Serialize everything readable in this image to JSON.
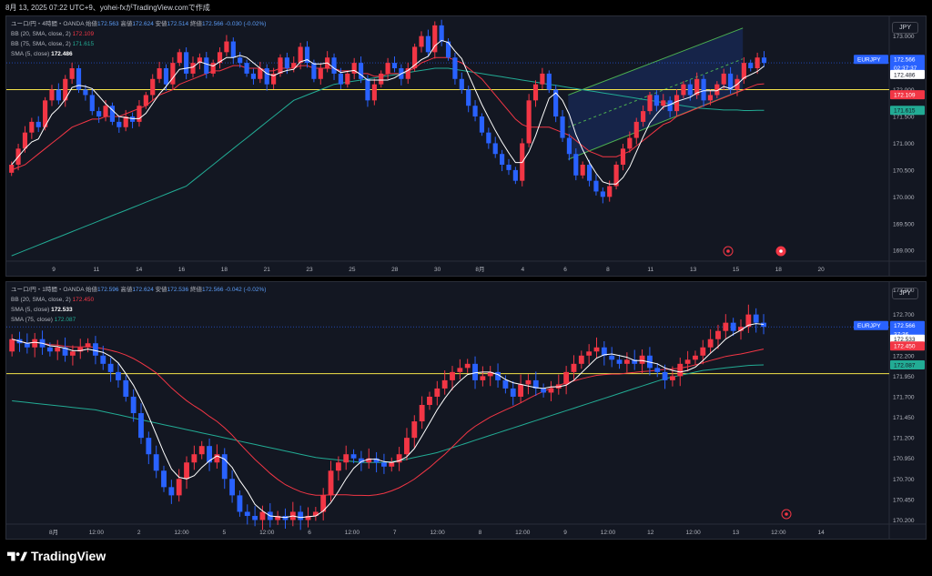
{
  "header": {
    "text": "8月 13, 2025 07:22 UTC+9、yohei-fxがTradingView.comで作成"
  },
  "footer": {
    "brand": "TradingView"
  },
  "colors": {
    "up": "#f23645",
    "down": "#2962ff",
    "bb20": "#f23645",
    "bb75": "#22ab94",
    "sma5": "#ffffff",
    "hline": "#f5e44a",
    "channel": "#4caf50"
  },
  "pane1": {
    "symbol_line": "ユーロ/円・4時間・OANDA",
    "ohlc": {
      "o_label": "始値",
      "o": "172.563",
      "h_label": "高値",
      "h": "172.624",
      "l_label": "安値",
      "l": "172.514",
      "c_label": "終値",
      "c": "172.566",
      "chg": "-0.030 (-0.02%)"
    },
    "ind1_label": "BB (20, SMA, close, 2)",
    "ind1_val": "172.109",
    "ind2_label": "BB (75, SMA, close, 2)",
    "ind2_val": "171.615",
    "ind3_label": "SMA (5, close)",
    "ind3_val": "172.486",
    "currency": "JPY",
    "badges": {
      "sym": "EURJPY",
      "price": "172.566",
      "timer": "02:37:37",
      "sma": "172.486",
      "bb20": "172.109",
      "bb75": "171.615"
    }
  },
  "pane2": {
    "symbol_line": "ユーロ/円・1時間・OANDA",
    "ohlc": {
      "o_label": "始値",
      "o": "172.596",
      "h_label": "高値",
      "h": "172.624",
      "l_label": "安値",
      "l": "172.536",
      "c_label": "終値",
      "c": "172.566",
      "chg": "-0.042 (-0.02%)"
    },
    "ind1_label": "BB (20, SMA, close, 2)",
    "ind1_val": "172.450",
    "ind2_label": "SMA (5, close)",
    "ind2_val": "172.533",
    "ind3_label": "SMA (75, close)",
    "ind3_val": "172.087",
    "currency": "JPY",
    "badges": {
      "sym": "EURJPY",
      "price": "172.566",
      "timer": "37:36",
      "sma": "172.533",
      "bb20": "172.450",
      "sma75": "172.087"
    }
  },
  "chart_data": [
    {
      "type": "candlestick",
      "title": "ユーロ/円・4時間・OANDA",
      "ylim": [
        168.8,
        173.3
      ],
      "yticks": [
        "173.500",
        "173.000",
        "172.500",
        "172.000",
        "171.500",
        "171.000",
        "170.500",
        "170.000",
        "169.500",
        "169.000"
      ],
      "xticks": [
        "9",
        "11",
        "14",
        "16",
        "18",
        "21",
        "23",
        "25",
        "28",
        "30",
        "8月",
        "4",
        "6",
        "8",
        "11",
        "13",
        "15",
        "18",
        "20"
      ],
      "hline": 172.0,
      "closes": [
        170.6,
        170.9,
        171.2,
        171.4,
        171.3,
        171.8,
        172.0,
        171.8,
        172.2,
        172.4,
        172.0,
        171.9,
        171.6,
        171.5,
        171.7,
        171.4,
        171.3,
        171.5,
        171.4,
        171.7,
        171.9,
        172.2,
        172.4,
        172.1,
        172.5,
        172.7,
        172.3,
        172.5,
        172.6,
        172.3,
        172.5,
        172.7,
        172.9,
        172.6,
        172.5,
        172.3,
        172.2,
        172.4,
        172.1,
        172.3,
        172.6,
        172.4,
        172.5,
        172.8,
        172.5,
        172.2,
        172.4,
        172.6,
        172.3,
        172.1,
        172.3,
        172.5,
        172.2,
        171.8,
        172.1,
        172.3,
        172.5,
        172.4,
        172.2,
        172.4,
        172.8,
        173.0,
        172.7,
        173.2,
        172.9,
        172.6,
        172.2,
        172.0,
        171.7,
        171.5,
        171.2,
        171.0,
        170.8,
        170.6,
        170.5,
        170.3,
        171.0,
        171.8,
        172.1,
        172.3,
        172.0,
        171.5,
        171.1,
        170.8,
        170.4,
        170.6,
        170.3,
        170.1,
        170.0,
        170.2,
        170.6,
        170.9,
        171.1,
        171.4,
        171.6,
        171.9,
        171.7,
        171.8,
        171.6,
        171.9,
        172.1,
        171.9,
        172.2,
        171.8,
        171.9,
        172.1,
        172.3,
        172.0,
        172.2,
        172.5,
        172.4,
        172.6,
        172.5
      ],
      "bb20": [
        170.5,
        170.55,
        170.6,
        170.7,
        170.8,
        170.9,
        171.0,
        171.1,
        171.2,
        171.3,
        171.35,
        171.4,
        171.45,
        171.45,
        171.5,
        171.5,
        171.5,
        171.55,
        171.6,
        171.65,
        171.7,
        171.8,
        171.9,
        171.95,
        172.0,
        172.1,
        172.15,
        172.2,
        172.25,
        172.3,
        172.35,
        172.35,
        172.4,
        172.45,
        172.45,
        172.4,
        172.4,
        172.4,
        172.35,
        172.35,
        172.4,
        172.4,
        172.4,
        172.45,
        172.45,
        172.4,
        172.4,
        172.4,
        172.4,
        172.35,
        172.35,
        172.35,
        172.3,
        172.3,
        172.25,
        172.25,
        172.3,
        172.3,
        172.3,
        172.35,
        172.4,
        172.5,
        172.55,
        172.6,
        172.6,
        172.6,
        172.55,
        172.5,
        172.4,
        172.3,
        172.2,
        172.05,
        171.9,
        171.75,
        171.6,
        171.45,
        171.35,
        171.3,
        171.3,
        171.3,
        171.3,
        171.25,
        171.2,
        171.15,
        171.05,
        170.95,
        170.85,
        170.8,
        170.75,
        170.75,
        170.75,
        170.8,
        170.85,
        170.95,
        171.05,
        171.15,
        171.25,
        171.35,
        171.4,
        171.5,
        171.55,
        171.6,
        171.65,
        171.7,
        171.75,
        171.8,
        171.85,
        171.9,
        171.95,
        172.0,
        172.05,
        172.1,
        172.11
      ],
      "bb75": [
        168.9,
        168.95,
        169.0,
        169.05,
        169.1,
        169.15,
        169.2,
        169.25,
        169.3,
        169.35,
        169.4,
        169.45,
        169.5,
        169.55,
        169.6,
        169.65,
        169.7,
        169.75,
        169.8,
        169.85,
        169.9,
        169.95,
        170.0,
        170.05,
        170.1,
        170.15,
        170.2,
        170.3,
        170.4,
        170.5,
        170.6,
        170.7,
        170.8,
        170.9,
        171.0,
        171.1,
        171.2,
        171.3,
        171.4,
        171.5,
        171.6,
        171.7,
        171.8,
        171.85,
        171.9,
        171.95,
        172.0,
        172.05,
        172.1,
        172.12,
        172.14,
        172.16,
        172.18,
        172.2,
        172.22,
        172.24,
        172.26,
        172.28,
        172.3,
        172.32,
        172.34,
        172.36,
        172.38,
        172.4,
        172.4,
        172.4,
        172.38,
        172.36,
        172.34,
        172.32,
        172.3,
        172.28,
        172.26,
        172.24,
        172.22,
        172.2,
        172.18,
        172.16,
        172.14,
        172.12,
        172.1,
        172.08,
        172.06,
        172.04,
        172.02,
        172.0,
        171.98,
        171.96,
        171.94,
        171.92,
        171.9,
        171.88,
        171.86,
        171.84,
        171.82,
        171.8,
        171.78,
        171.76,
        171.74,
        171.72,
        171.7,
        171.68,
        171.66,
        171.65,
        171.64,
        171.63,
        171.62,
        171.62,
        171.62,
        171.61,
        171.61,
        171.615,
        171.615
      ],
      "channel": {
        "lower": [
          [
            0.74,
            170.7
          ],
          [
            0.97,
            172.0
          ]
        ],
        "upper": [
          [
            0.74,
            171.9
          ],
          [
            0.97,
            173.15
          ]
        ]
      }
    },
    {
      "type": "candlestick",
      "title": "ユーロ/円・1時間・OANDA",
      "ylim": [
        170.15,
        173.05
      ],
      "yticks": [
        "173.000",
        "172.700",
        "172.450",
        "172.200",
        "171.950",
        "171.700",
        "171.450",
        "171.200",
        "170.950",
        "170.700",
        "170.450",
        "170.200"
      ],
      "xticks": [
        "8月",
        "12:00",
        "2",
        "12:00",
        "5",
        "12:00",
        "6",
        "12:00",
        "7",
        "12:00",
        "8",
        "12:00",
        "9",
        "12:00",
        "12",
        "12:00",
        "13",
        "12:00",
        "14"
      ],
      "hline": 171.98,
      "closes": [
        172.4,
        172.35,
        172.3,
        172.4,
        172.3,
        172.25,
        172.3,
        172.2,
        172.25,
        172.3,
        172.35,
        172.2,
        172.1,
        172.0,
        171.9,
        171.7,
        171.5,
        171.2,
        171.0,
        170.8,
        170.6,
        170.5,
        170.7,
        170.9,
        171.0,
        171.1,
        170.9,
        171.0,
        170.7,
        170.5,
        170.3,
        170.25,
        170.2,
        170.3,
        170.2,
        170.25,
        170.2,
        170.3,
        170.2,
        170.25,
        170.3,
        170.5,
        170.8,
        170.9,
        171.0,
        170.95,
        170.9,
        170.95,
        170.9,
        170.85,
        170.9,
        171.0,
        171.2,
        171.4,
        171.6,
        171.7,
        171.8,
        171.9,
        172.0,
        172.05,
        172.1,
        171.9,
        171.95,
        172.0,
        171.9,
        171.8,
        171.7,
        171.85,
        171.9,
        171.8,
        171.75,
        171.8,
        171.85,
        172.0,
        172.1,
        172.2,
        172.25,
        172.3,
        172.2,
        172.15,
        172.1,
        172.15,
        172.1,
        172.2,
        172.05,
        172.0,
        171.9,
        171.95,
        172.1,
        172.15,
        172.2,
        172.3,
        172.4,
        172.5,
        172.6,
        172.5,
        172.55,
        172.7,
        172.6,
        172.55
      ],
      "sma75": [
        171.65,
        171.64,
        171.63,
        171.62,
        171.61,
        171.6,
        171.59,
        171.58,
        171.57,
        171.56,
        171.55,
        171.54,
        171.52,
        171.5,
        171.48,
        171.46,
        171.44,
        171.42,
        171.4,
        171.38,
        171.36,
        171.34,
        171.32,
        171.3,
        171.28,
        171.26,
        171.24,
        171.22,
        171.2,
        171.18,
        171.16,
        171.14,
        171.12,
        171.1,
        171.08,
        171.06,
        171.04,
        171.02,
        171.0,
        170.98,
        170.96,
        170.95,
        170.94,
        170.93,
        170.92,
        170.91,
        170.9,
        170.9,
        170.9,
        170.9,
        170.91,
        170.92,
        170.94,
        170.96,
        170.98,
        171.0,
        171.02,
        171.05,
        171.08,
        171.11,
        171.14,
        171.17,
        171.2,
        171.23,
        171.26,
        171.29,
        171.32,
        171.35,
        171.38,
        171.41,
        171.44,
        171.47,
        171.5,
        171.53,
        171.56,
        171.59,
        171.62,
        171.65,
        171.68,
        171.71,
        171.74,
        171.77,
        171.8,
        171.83,
        171.86,
        171.89,
        171.92,
        171.94,
        171.96,
        171.98,
        172.0,
        172.02,
        172.03,
        172.04,
        172.05,
        172.06,
        172.07,
        172.08,
        172.085,
        172.087
      ]
    }
  ]
}
